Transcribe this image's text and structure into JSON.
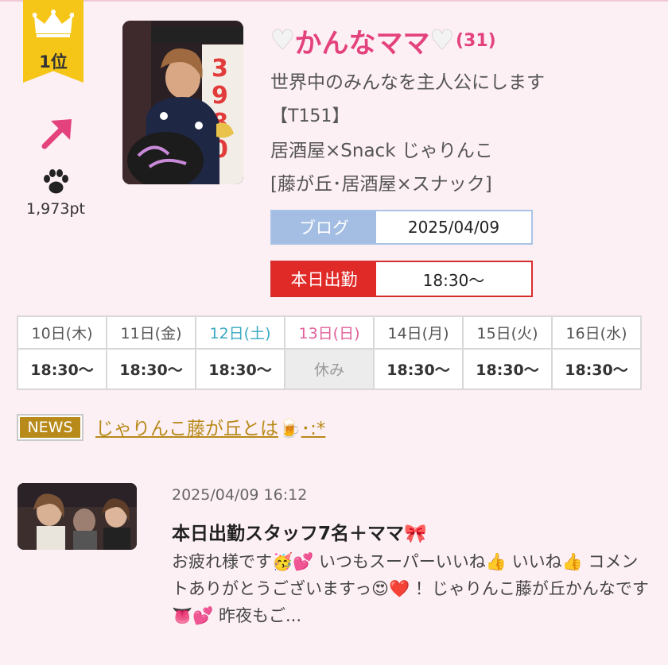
{
  "rank": {
    "label": "1位",
    "points": "1,973pt",
    "trend_icon": "arrow-up-right-icon",
    "points_icon": "paw-icon"
  },
  "profile": {
    "name": "かんなママ",
    "age": "(31)",
    "catchphrase": "世界中のみんなを主人公にします",
    "tall": "【T151】",
    "shop": "居酒屋×Snack じゃりんこ",
    "area": "[藤が丘･居酒屋×スナック]"
  },
  "blog_box": {
    "label": "ブログ",
    "date": "2025/04/09"
  },
  "work_box": {
    "label": "本日出勤",
    "time": "18:30〜"
  },
  "schedule": [
    {
      "day": "10日(木)",
      "time": "18:30〜"
    },
    {
      "day": "11日(金)",
      "time": "18:30〜"
    },
    {
      "day": "12日(土)",
      "time": "18:30〜"
    },
    {
      "day": "13日(日)",
      "time": "休み"
    },
    {
      "day": "14日(月)",
      "time": "18:30〜"
    },
    {
      "day": "15日(火)",
      "time": "18:30〜"
    },
    {
      "day": "16日(水)",
      "time": "18:30〜"
    }
  ],
  "news": {
    "badge": "NEWS",
    "link": "じゃりんこ藤が丘とは",
    "link_suffix": "･:*"
  },
  "blog_entry": {
    "date": "2025/04/09 16:12",
    "title": "本日出勤スタッフ7名＋ママ",
    "excerpt": "お疲れ様です🥳💕 いつもスーパーいいね👍 いいね👍 コメントありがとうございますっ😍❤️ ！じゃりんこ藤が丘かんなです👅💕 昨夜もご..."
  },
  "colors": {
    "accent": "#e3427d",
    "gold": "#b88a1a",
    "work_red": "#e02a27",
    "blog_blue": "#a3bde3",
    "background": "#fdf0f4"
  }
}
